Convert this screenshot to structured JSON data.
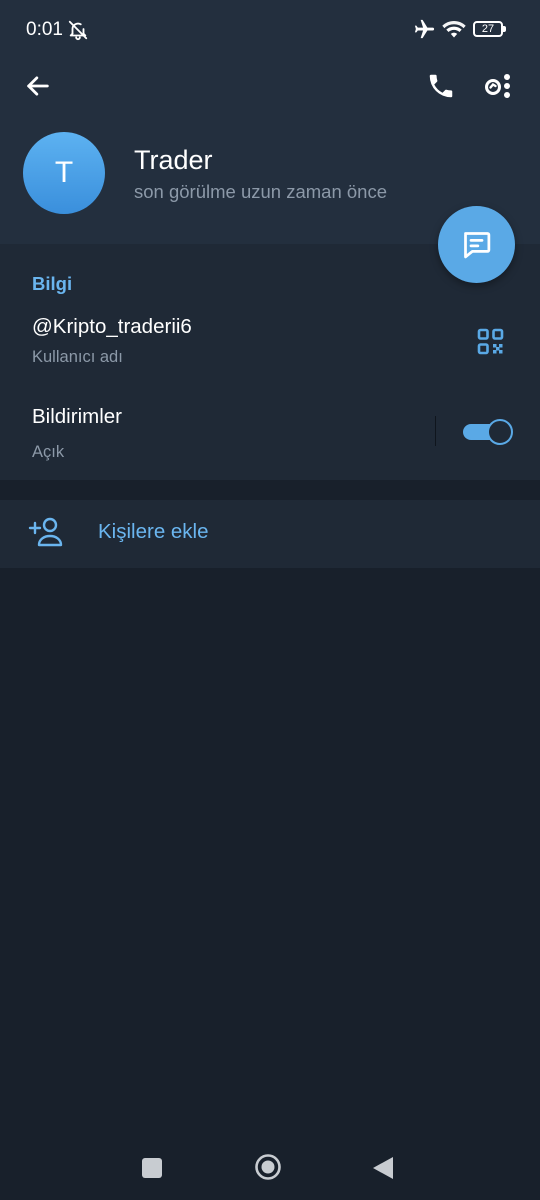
{
  "status_bar": {
    "time": "0:01",
    "battery": "27"
  },
  "profile": {
    "avatar_letter": "T",
    "name": "Trader",
    "status": "son görülme uzun zaman önce"
  },
  "info": {
    "section_title": "Bilgi",
    "username": "@Kripto_traderii6",
    "username_caption": "Kullanıcı adı",
    "notifications_title": "Bildirimler",
    "notifications_caption": "Açık",
    "notifications_enabled": true
  },
  "add_contact": {
    "label": "Kişilere ekle"
  },
  "colors": {
    "accent": "#5aa9e6",
    "header_bg": "#232f3e",
    "card_bg": "#1f2936",
    "page_bg": "#18202b"
  }
}
